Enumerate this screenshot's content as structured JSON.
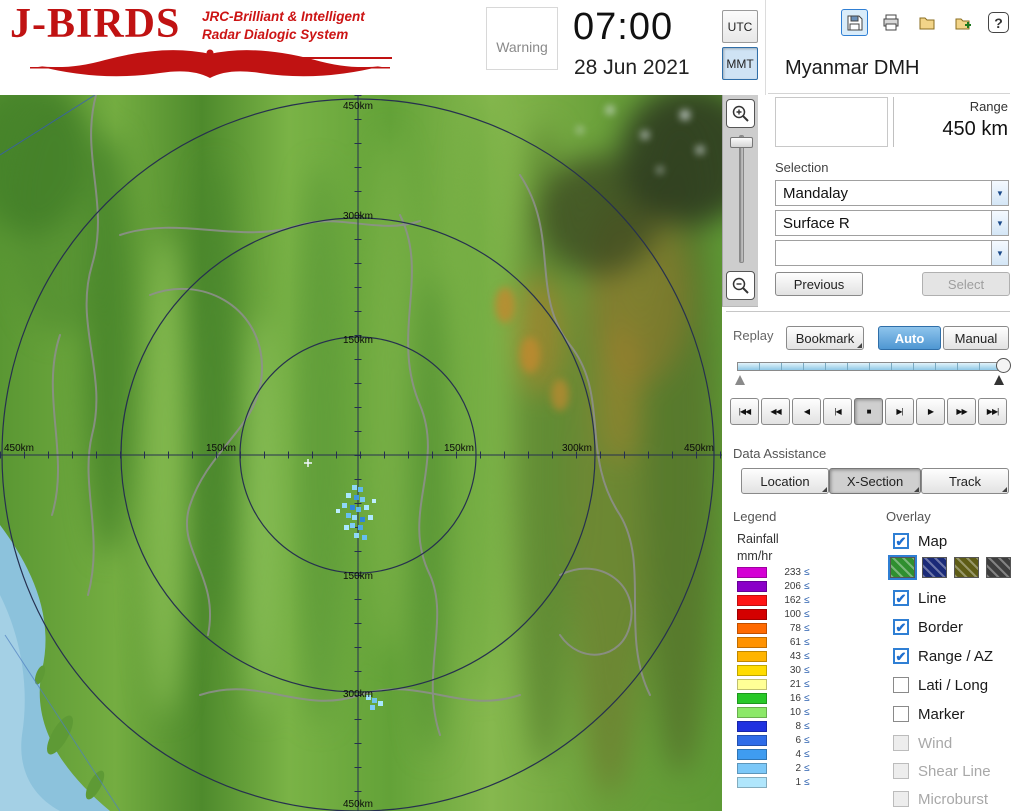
{
  "header": {
    "logo": {
      "title": "J-BIRDS",
      "subtitle_line1": "JRC-Brilliant & Intelligent",
      "subtitle_line2": "Radar  Dialogic System"
    },
    "warning": "Warning",
    "time": "07:00",
    "date": "28 Jun 2021",
    "utc": "UTC",
    "mmt": "MMT",
    "station": "Myanmar DMH",
    "help_glyph": "?"
  },
  "icons": {
    "check": "✔",
    "dropdown_arrow": "▼"
  },
  "range": {
    "label": "Range",
    "value": "450 km"
  },
  "selection": {
    "label": "Selection",
    "dropdown1": "Mandalay",
    "dropdown2": "Surface R",
    "dropdown3": "",
    "previous": "Previous",
    "select": "Select"
  },
  "replay": {
    "label": "Replay",
    "bookmark": "Bookmark",
    "auto": "Auto",
    "manual": "Manual"
  },
  "playback": {
    "buttons": [
      "|◀◀",
      "◀◀",
      "◀",
      "|◀",
      "■",
      "▶|",
      "▶",
      "▶▶",
      "▶▶|"
    ]
  },
  "assist": {
    "label": "Data Assistance",
    "location": "Location",
    "xsection": "X-Section",
    "track": "Track"
  },
  "legend": {
    "label": "Legend",
    "unit_line1": "Rainfall",
    "unit_line2": "mm/hr",
    "rows": [
      {
        "value": "233",
        "op": "≤",
        "color": "#d400d4"
      },
      {
        "value": "206",
        "op": "≤",
        "color": "#8a00c8"
      },
      {
        "value": "162",
        "op": "≤",
        "color": "#ff1414"
      },
      {
        "value": "100",
        "op": "≤",
        "color": "#d40000"
      },
      {
        "value": "78",
        "op": "≤",
        "color": "#ff6a00"
      },
      {
        "value": "61",
        "op": "≤",
        "color": "#ff9200"
      },
      {
        "value": "43",
        "op": "≤",
        "color": "#ffb400"
      },
      {
        "value": "30",
        "op": "≤",
        "color": "#ffdc00"
      },
      {
        "value": "21",
        "op": "≤",
        "color": "#ffff96"
      },
      {
        "value": "16",
        "op": "≤",
        "color": "#28c828"
      },
      {
        "value": "10",
        "op": "≤",
        "color": "#8ce868"
      },
      {
        "value": "8",
        "op": "≤",
        "color": "#1f32e0"
      },
      {
        "value": "6",
        "op": "≤",
        "color": "#2f6ce8"
      },
      {
        "value": "4",
        "op": "≤",
        "color": "#3f9cf0"
      },
      {
        "value": "2",
        "op": "≤",
        "color": "#7cc8f8"
      },
      {
        "value": "1",
        "op": "≤",
        "color": "#b0e6fc"
      }
    ]
  },
  "overlay": {
    "label": "Overlay",
    "items": [
      {
        "label": "Map",
        "checked": true,
        "disabled": false
      },
      {
        "label": "Line",
        "checked": true,
        "disabled": false
      },
      {
        "label": "Border",
        "checked": true,
        "disabled": false
      },
      {
        "label": "Range / AZ",
        "checked": true,
        "disabled": false
      },
      {
        "label": "Lati / Long",
        "checked": false,
        "disabled": false
      },
      {
        "label": "Marker",
        "checked": false,
        "disabled": false
      },
      {
        "label": "Wind",
        "checked": false,
        "disabled": true
      },
      {
        "label": "Shear Line",
        "checked": false,
        "disabled": true
      },
      {
        "label": "Microburst",
        "checked": false,
        "disabled": true
      }
    ],
    "map_styles": [
      "#2f8f2f",
      "#1a2a78",
      "#5e5c16",
      "#3e3e3e"
    ]
  },
  "map": {
    "v_labels": [
      "450km",
      "300km",
      "150km",
      "150km",
      "300km",
      "450km"
    ],
    "h_labels": [
      "450km",
      "150km",
      "150km",
      "300km",
      "450km"
    ]
  },
  "accent": {
    "selection_blue": "#2f7fd4"
  }
}
